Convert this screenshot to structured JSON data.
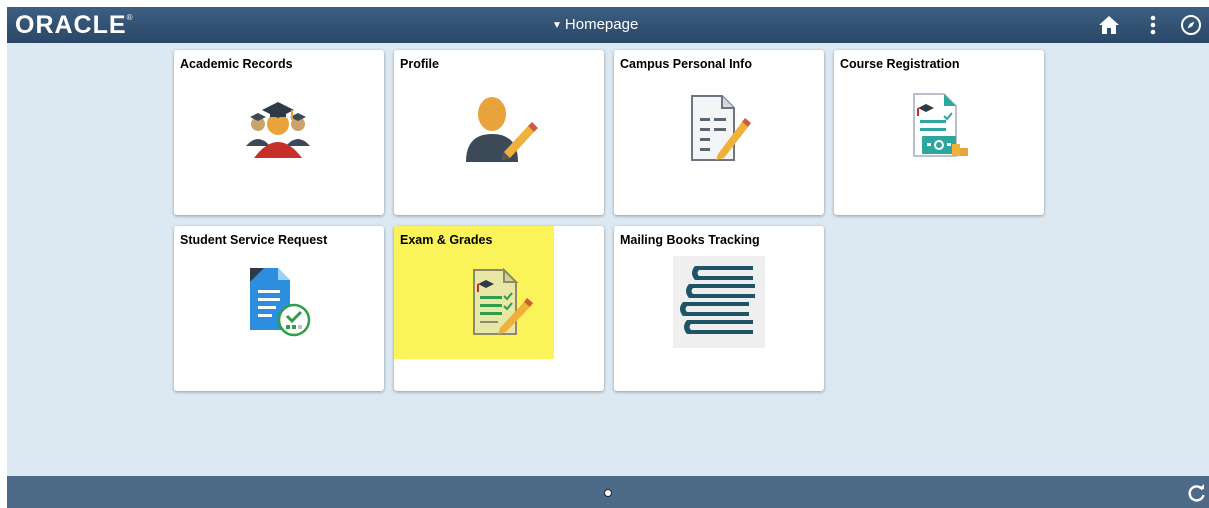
{
  "header": {
    "logo": "ORACLE",
    "logo_mark": "®",
    "page_title": "Homepage",
    "icons": [
      "home-icon",
      "more-options-icon",
      "navbar-compass-icon"
    ]
  },
  "tiles": [
    {
      "label": "Academic Records",
      "icon": "graduate-group-icon"
    },
    {
      "label": "Profile",
      "icon": "person-edit-icon"
    },
    {
      "label": "Campus Personal Info",
      "icon": "document-edit-icon"
    },
    {
      "label": "Course Registration",
      "icon": "course-certificate-icon"
    },
    {
      "label": "Student Service Request",
      "icon": "document-check-icon"
    },
    {
      "label": "Exam & Grades",
      "icon": "grades-document-icon"
    },
    {
      "label": "Mailing Books Tracking",
      "icon": "books-stack-icon"
    }
  ],
  "footer": {
    "icons": [
      "page-indicator-dot",
      "refresh-icon"
    ]
  },
  "colors": {
    "header": "#2f4d6e",
    "background": "#dce8f2",
    "footer": "#4d6a88",
    "highlight": "#fbf35a"
  }
}
